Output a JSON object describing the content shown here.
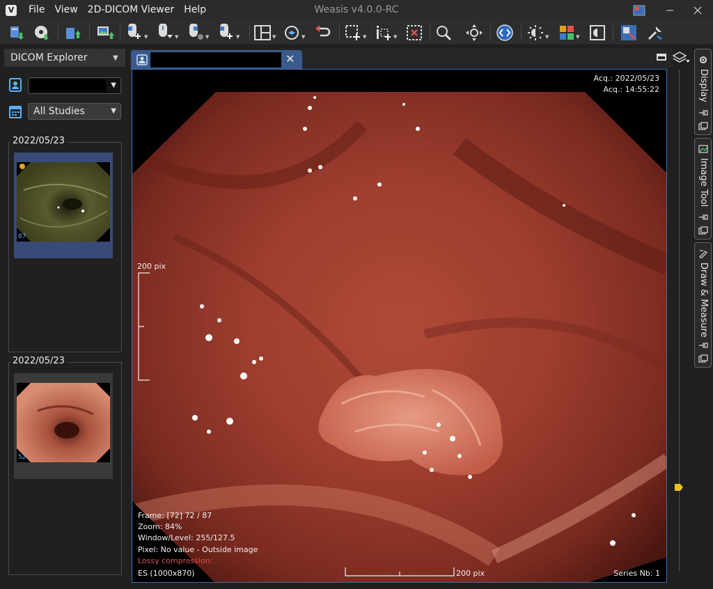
{
  "app": {
    "title": "Weasis v4.0.0-RC",
    "menu": [
      "File",
      "View",
      "2D-DICOM Viewer",
      "Help"
    ]
  },
  "explorer": {
    "title": "DICOM Explorer",
    "patient_value": "",
    "studies_value": "All Studies",
    "studies": [
      {
        "date": "2022/05/23",
        "frames": "87",
        "selected": true
      },
      {
        "date": "2022/05/23",
        "frames": "52",
        "selected": false
      }
    ]
  },
  "viewer": {
    "tab_label": "",
    "overlay": {
      "acq_date": "Acq.: 2022/05/23",
      "acq_time": "Acq.: 14:55:22",
      "scale_left": "200 pix",
      "frame": "Frame: [72] 72 / 87",
      "zoom": "Zoom: 84%",
      "window_level": "Window/Level: 255/127.5",
      "pixel": "Pixel: No value - Outside image",
      "lossy": "Lossy compression:",
      "modality": "ES (1000x870)",
      "scale_bottom": "200 pix",
      "series": "Series Nb: 1"
    }
  },
  "side_tabs": [
    "Display",
    "Image Tool",
    "Draw & Measure"
  ],
  "colors": {
    "accent": "#3b6fb0",
    "lossy": "#e05050",
    "frame_count": "#5ab0ff"
  }
}
